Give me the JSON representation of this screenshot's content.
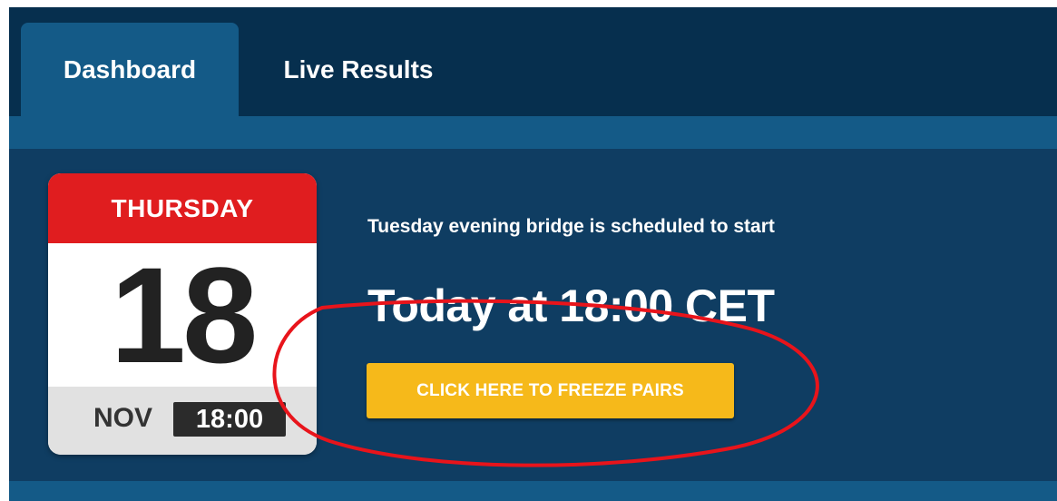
{
  "tabs": [
    {
      "label": "Dashboard",
      "active": true
    },
    {
      "label": "Live Results",
      "active": false
    }
  ],
  "calendar": {
    "weekday": "THURSDAY",
    "day": "18",
    "month": "NOV",
    "time": "18:00"
  },
  "event": {
    "scheduled_text": "Tuesday evening bridge is scheduled to start",
    "start_text": "Today at 18:00 CET",
    "freeze_button_label": "CLICK HERE TO FREEZE PAIRS"
  },
  "colors": {
    "background": "#0f3d62",
    "tabbar": "#062f4e",
    "accent_blue": "#145a87",
    "calendar_red": "#e01d1f",
    "button_yellow": "#f6b91a",
    "annotation_red": "#e8141b"
  }
}
